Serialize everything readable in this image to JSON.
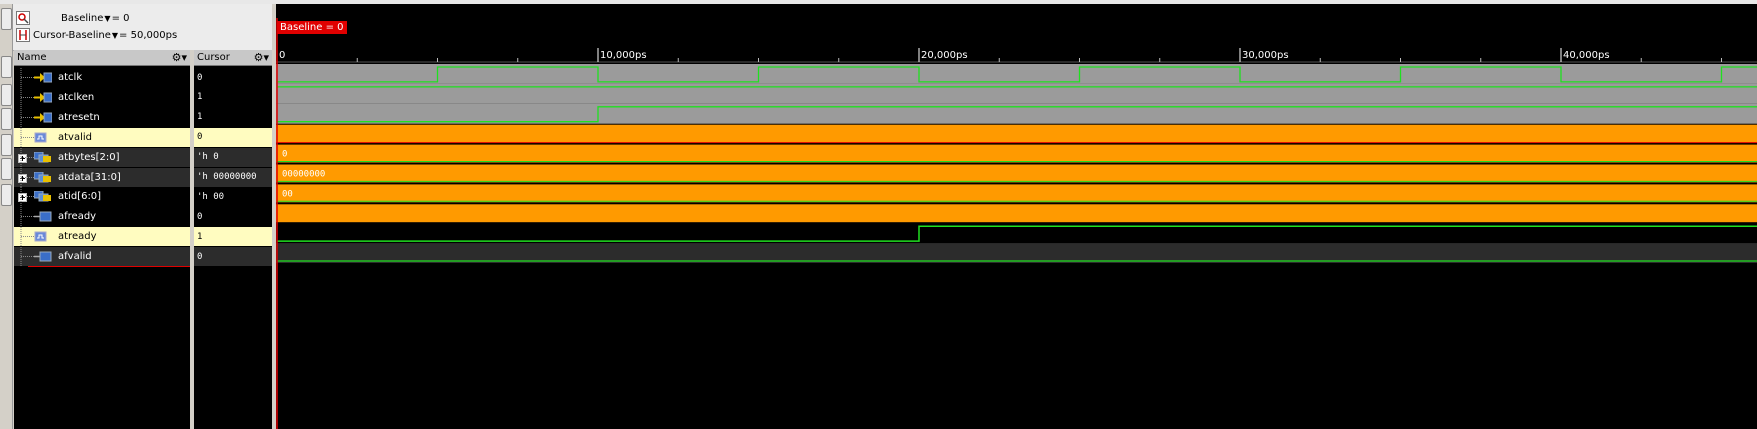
{
  "info": {
    "baseline_label": "Baseline",
    "baseline_value": "= 0",
    "cursor_label": "Cursor-Baseline",
    "cursor_value": "= 50,000ps"
  },
  "headers": {
    "name": "Name",
    "value": "Cursor"
  },
  "baseline_tag": "Baseline = 0",
  "timeline": {
    "ticks": [
      {
        "t": 0,
        "label": "0"
      },
      {
        "t": 10000,
        "label": "10,000ps"
      },
      {
        "t": 20000,
        "label": "20,000ps"
      },
      {
        "t": 30000,
        "label": "30,000ps"
      },
      {
        "t": 40000,
        "label": "40,000ps"
      }
    ],
    "minor_step_ps": 2500
  },
  "signals": [
    {
      "name": "atclk",
      "value": "0",
      "icon": "input-arrow-icon",
      "expandable": false,
      "bg": "normal",
      "wave": {
        "type": "clock",
        "period": 10000,
        "start_low": true
      }
    },
    {
      "name": "atclken",
      "value": "1",
      "icon": "input-arrow-icon",
      "expandable": false,
      "bg": "normal",
      "wave": {
        "type": "const_high"
      }
    },
    {
      "name": "atresetn",
      "value": "1",
      "icon": "input-arrow-icon",
      "expandable": false,
      "bg": "normal",
      "wave": {
        "type": "rise",
        "at": 10000
      }
    },
    {
      "name": "atvalid",
      "value": "0",
      "icon": "signal-icon",
      "expandable": false,
      "bg": "highlight",
      "wave": {
        "type": "bus_x"
      }
    },
    {
      "name": "atbytes[2:0]",
      "value": "'h 0",
      "icon": "bus-icon",
      "expandable": true,
      "bg": "dark",
      "wave": {
        "type": "bus",
        "label": "0"
      }
    },
    {
      "name": "atdata[31:0]",
      "value": "'h 00000000",
      "icon": "bus-icon",
      "expandable": true,
      "bg": "dark",
      "wave": {
        "type": "bus",
        "label": "00000000"
      }
    },
    {
      "name": "atid[6:0]",
      "value": "'h 00",
      "icon": "bus-icon",
      "expandable": true,
      "bg": "normal",
      "wave": {
        "type": "bus",
        "label": "00"
      }
    },
    {
      "name": "afready",
      "value": "0",
      "icon": "output-icon",
      "expandable": false,
      "bg": "normal",
      "wave": {
        "type": "bus_x"
      }
    },
    {
      "name": "atready",
      "value": "1",
      "icon": "signal-icon",
      "expandable": false,
      "bg": "highlight",
      "wave": {
        "type": "rise_from_low",
        "at": 20000
      }
    },
    {
      "name": "afvalid",
      "value": "0",
      "icon": "output-icon",
      "expandable": false,
      "bg": "dark",
      "wave": {
        "type": "const_low"
      }
    }
  ],
  "colors": {
    "wave_green": "#20e020",
    "wave_gray": "#9b9b9b",
    "wave_orange": "#ff9a00",
    "baseline_red": "#e00000",
    "highlight_row": "#fffcc0"
  }
}
